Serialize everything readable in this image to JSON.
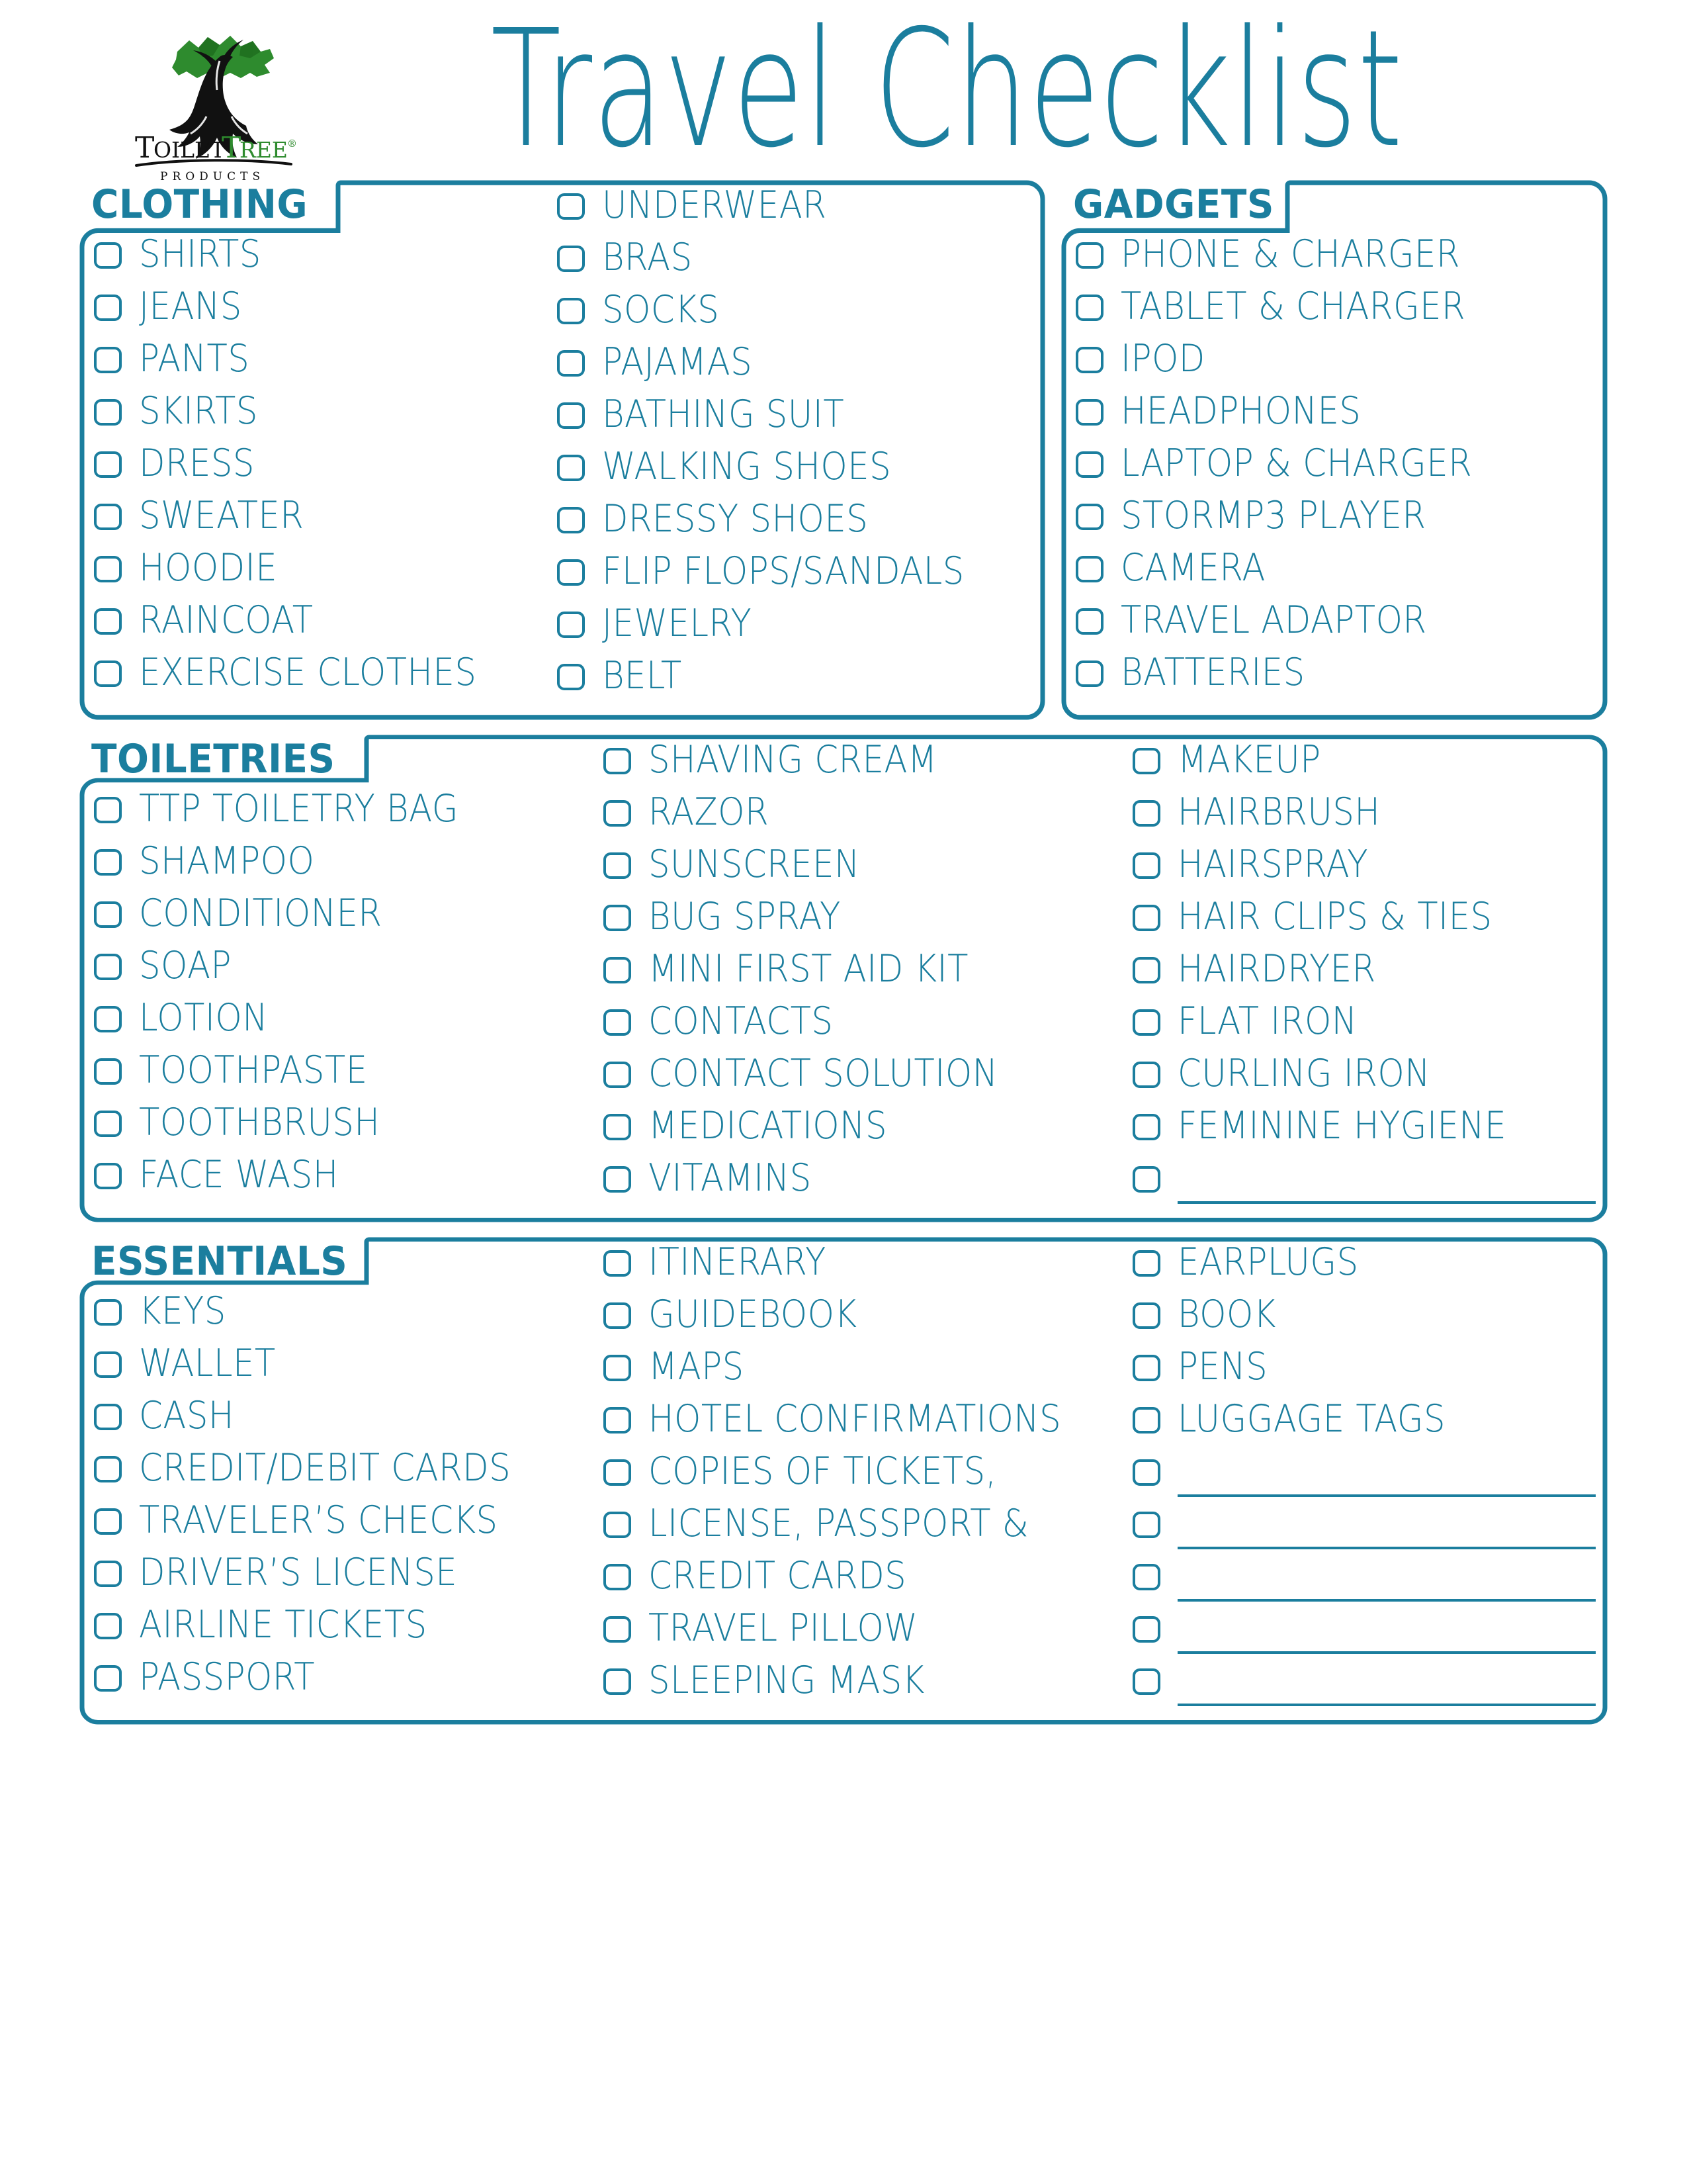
{
  "brand": {
    "name_part1": "TOILET",
    "name_part2": "TREE",
    "registered_mark": "®",
    "tagline": "P R O D U C T S"
  },
  "header": {
    "title": "Travel Checklist"
  },
  "sections": [
    {
      "id": "clothing",
      "title": "CLOTHING",
      "columns": [
        {
          "raised": false,
          "items": [
            {
              "label": "SHIRTS"
            },
            {
              "label": "JEANS"
            },
            {
              "label": "PANTS"
            },
            {
              "label": "SKIRTS"
            },
            {
              "label": "DRESS"
            },
            {
              "label": "SWEATER"
            },
            {
              "label": "HOODIE"
            },
            {
              "label": "RAINCOAT"
            },
            {
              "label": "EXERCISE CLOTHES"
            }
          ]
        },
        {
          "raised": true,
          "items": [
            {
              "label": "UNDERWEAR"
            },
            {
              "label": "BRAS"
            },
            {
              "label": "SOCKS"
            },
            {
              "label": "PAJAMAS"
            },
            {
              "label": "BATHING SUIT"
            },
            {
              "label": "WALKING SHOES"
            },
            {
              "label": "DRESSY SHOES"
            },
            {
              "label": "FLIP FLOPS/SANDALS"
            },
            {
              "label": "JEWELRY"
            },
            {
              "label": "BELT"
            }
          ]
        }
      ]
    },
    {
      "id": "gadgets",
      "title": "GADGETS",
      "columns": [
        {
          "raised": false,
          "items": [
            {
              "label": "PHONE & CHARGER"
            },
            {
              "label": "TABLET & CHARGER"
            },
            {
              "label": "IPOD"
            },
            {
              "label": "HEADPHONES"
            },
            {
              "label": "LAPTOP & CHARGER"
            },
            {
              "label": "STORMP3 PLAYER"
            },
            {
              "label": "CAMERA"
            },
            {
              "label": "TRAVEL ADAPTOR"
            },
            {
              "label": "BATTERIES"
            }
          ]
        }
      ]
    },
    {
      "id": "toiletries",
      "title": "TOILETRIES",
      "columns": [
        {
          "raised": false,
          "items": [
            {
              "label": "TTP TOILETRY BAG"
            },
            {
              "label": "SHAMPOO"
            },
            {
              "label": "CONDITIONER"
            },
            {
              "label": "SOAP"
            },
            {
              "label": "LOTION"
            },
            {
              "label": "TOOTHPASTE"
            },
            {
              "label": "TOOTHBRUSH"
            },
            {
              "label": "FACE WASH"
            }
          ]
        },
        {
          "raised": true,
          "items": [
            {
              "label": "SHAVING CREAM"
            },
            {
              "label": "RAZOR"
            },
            {
              "label": "SUNSCREEN"
            },
            {
              "label": "BUG SPRAY"
            },
            {
              "label": "MINI FIRST AID KIT"
            },
            {
              "label": "CONTACTS"
            },
            {
              "label": "CONTACT SOLUTION"
            },
            {
              "label": "MEDICATIONS"
            },
            {
              "label": "VITAMINS"
            }
          ]
        },
        {
          "raised": true,
          "items": [
            {
              "label": "MAKEUP"
            },
            {
              "label": "HAIRBRUSH"
            },
            {
              "label": "HAIRSPRAY"
            },
            {
              "label": "HAIR CLIPS & TIES"
            },
            {
              "label": "HAIRDRYER"
            },
            {
              "label": "FLAT IRON"
            },
            {
              "label": "CURLING IRON"
            },
            {
              "label": "FEMININE HYGIENE"
            },
            {
              "label": "",
              "blank": true
            }
          ]
        }
      ]
    },
    {
      "id": "essentials",
      "title": "ESSENTIALS",
      "columns": [
        {
          "raised": false,
          "items": [
            {
              "label": "KEYS"
            },
            {
              "label": "WALLET"
            },
            {
              "label": "CASH"
            },
            {
              "label": "CREDIT/DEBIT CARDS"
            },
            {
              "label": "TRAVELER’S CHECKS"
            },
            {
              "label": "DRIVER’S LICENSE"
            },
            {
              "label": "AIRLINE TICKETS"
            },
            {
              "label": "PASSPORT"
            }
          ]
        },
        {
          "raised": true,
          "items": [
            {
              "label": "ITINERARY"
            },
            {
              "label": "GUIDEBOOK"
            },
            {
              "label": "MAPS"
            },
            {
              "label": "HOTEL CONFIRMATIONS"
            },
            {
              "label": "COPIES OF TICKETS,"
            },
            {
              "label": "LICENSE, PASSPORT &"
            },
            {
              "label": "CREDIT CARDS"
            },
            {
              "label": "TRAVEL PILLOW"
            },
            {
              "label": "SLEEPING MASK"
            }
          ]
        },
        {
          "raised": true,
          "items": [
            {
              "label": "EARPLUGS"
            },
            {
              "label": "BOOK"
            },
            {
              "label": "PENS"
            },
            {
              "label": "LUGGAGE TAGS"
            },
            {
              "label": "",
              "blank": true
            },
            {
              "label": "",
              "blank": true
            },
            {
              "label": "",
              "blank": true
            },
            {
              "label": "",
              "blank": true
            },
            {
              "label": "",
              "blank": true
            }
          ]
        }
      ]
    }
  ],
  "colors": {
    "teal": "#1b7e9e",
    "logo_green": "#2f8a2f",
    "logo_dark": "#111111"
  }
}
